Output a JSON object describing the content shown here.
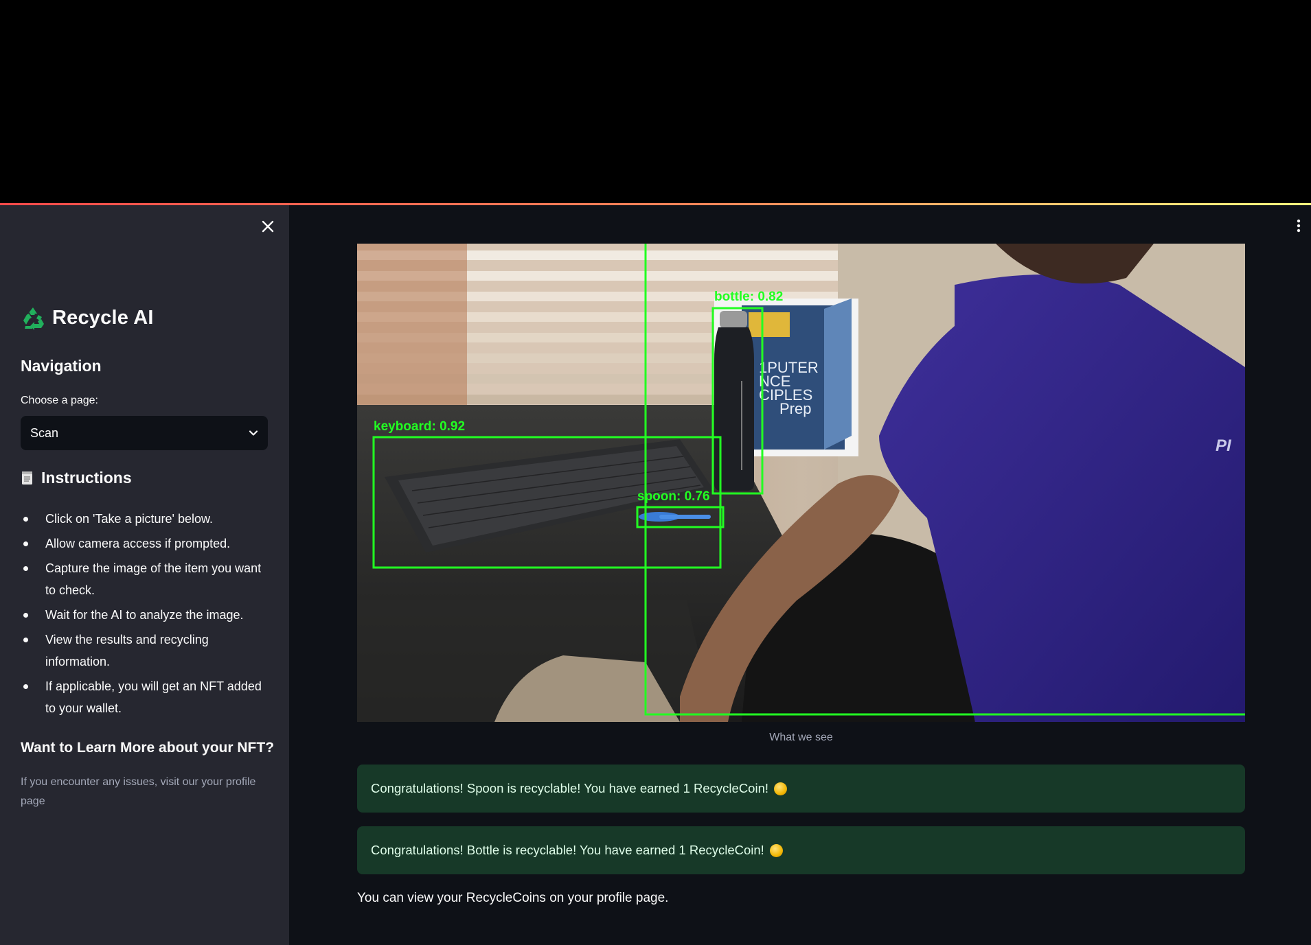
{
  "sidebar": {
    "close_icon": "close-icon",
    "brand": {
      "icon": "recycle-icon",
      "title": "Recycle AI"
    },
    "navigation_heading": "Navigation",
    "choose_label": "Choose a page:",
    "selected_page": "Scan",
    "instructions": {
      "icon": "document-icon",
      "title": "Instructions",
      "items": [
        "Click on 'Take a picture' below.",
        "Allow camera access if prompted.",
        "Capture the image of the item you want to check.",
        "Wait for the AI to analyze the image.",
        "View the results and recycling information.",
        "If applicable, you will get an NFT added to your wallet."
      ]
    },
    "learn_heading": "Want to Learn More about your NFT?",
    "learn_text": "If you encounter any issues, visit our your profile page"
  },
  "main": {
    "menu_icon": "more-vertical-icon",
    "image": {
      "detections": [
        {
          "label": "bottle: 0.82"
        },
        {
          "label": "keyboard: 0.92"
        },
        {
          "label": "spoon: 0.76"
        }
      ],
      "box_color": "#22ff22"
    },
    "caption": "What we see",
    "alerts": [
      "Congratulations! Spoon is recyclable! You have earned 1 RecycleCoin!",
      "Congratulations! Bottle is recyclable! You have earned 1 RecycleCoin!"
    ],
    "alert_icon": "coin-icon",
    "footer": "You can view your RecycleCoins on your profile page."
  },
  "colors": {
    "sidebar_bg": "#262730",
    "main_bg": "#0e1117",
    "alert_bg": "#173928",
    "accent_line": "#ff4b4b"
  }
}
